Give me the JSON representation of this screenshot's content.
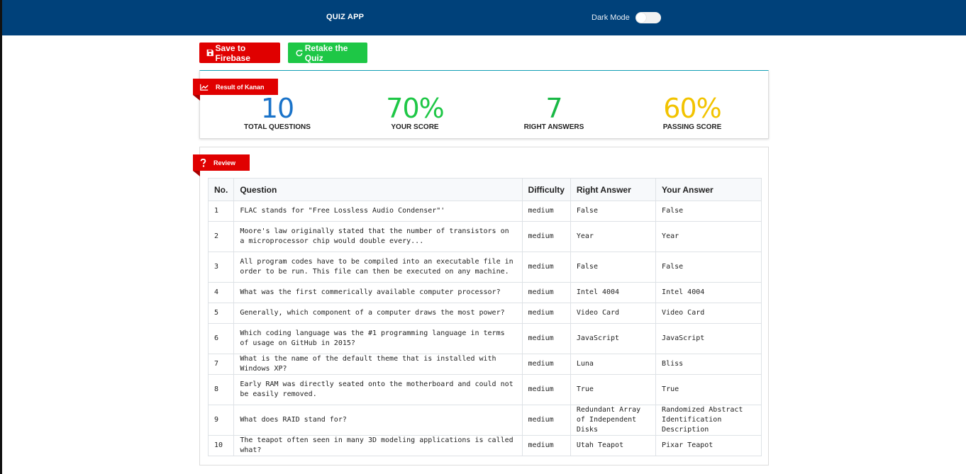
{
  "navbar": {
    "title": "QUIZ APP",
    "dark_mode_label": "Dark Mode",
    "dark_mode_on": false
  },
  "actions": {
    "save_label": "Save to Firebase",
    "retake_label": "Retake the Quiz"
  },
  "result": {
    "title": "Result of Kanan",
    "stats": [
      {
        "value": "10",
        "label": "TOTAL QUESTIONS",
        "color": "#1a73c9"
      },
      {
        "value": "70%",
        "label": "YOUR SCORE",
        "color": "#1ec746"
      },
      {
        "value": "7",
        "label": "RIGHT ANSWERS",
        "color": "#19b845"
      },
      {
        "value": "60%",
        "label": "PASSING SCORE",
        "color": "#f2c300"
      }
    ]
  },
  "review": {
    "title": "Review",
    "columns": [
      "No.",
      "Question",
      "Difficulty",
      "Right Answer",
      "Your Answer"
    ],
    "rows": [
      {
        "no": "1",
        "question": "FLAC stands for \"Free Lossless Audio Condenser\"'",
        "difficulty": "medium",
        "right": "False",
        "yours": "False"
      },
      {
        "no": "2",
        "question": "Moore's law originally stated that the number of transistors on a microprocessor chip would double every...",
        "difficulty": "medium",
        "right": "Year",
        "yours": "Year"
      },
      {
        "no": "3",
        "question": "All program codes have to be compiled into an executable file in order to be run. This file can then be executed on any machine.",
        "difficulty": "medium",
        "right": "False",
        "yours": "False"
      },
      {
        "no": "4",
        "question": "What was the first commerically available computer processor?",
        "difficulty": "medium",
        "right": "Intel 4004",
        "yours": "Intel 4004"
      },
      {
        "no": "5",
        "question": "Generally, which component of a computer draws the most power?",
        "difficulty": "medium",
        "right": "Video Card",
        "yours": "Video Card"
      },
      {
        "no": "6",
        "question": "Which coding language was the #1 programming language in terms of usage on GitHub in 2015?",
        "difficulty": "medium",
        "right": "JavaScript",
        "yours": "JavaScript"
      },
      {
        "no": "7",
        "question": "What is the name of the default theme that is installed with Windows XP?",
        "difficulty": "medium",
        "right": "Luna",
        "yours": "Bliss"
      },
      {
        "no": "8",
        "question": "Early RAM was directly seated onto the motherboard and could not be easily removed.",
        "difficulty": "medium",
        "right": "True",
        "yours": "True"
      },
      {
        "no": "9",
        "question": "What does RAID stand for?",
        "difficulty": "medium",
        "right": "Redundant Array of Independent Disks",
        "yours": "Randomized Abstract Identification Description"
      },
      {
        "no": "10",
        "question": "The teapot often seen in many 3D modeling applications is called what?",
        "difficulty": "medium",
        "right": "Utah Teapot",
        "yours": "Pixar Teapot"
      }
    ]
  }
}
